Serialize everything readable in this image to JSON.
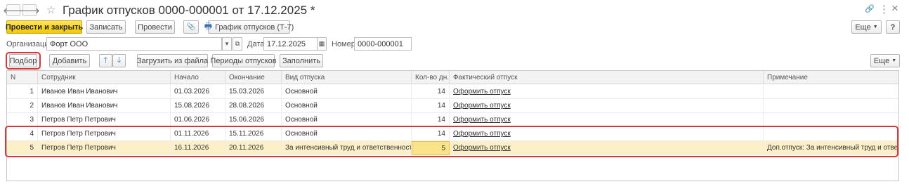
{
  "window": {
    "title": "График отпусков 0000-000001 от 17.12.2025 *",
    "back_icon": "arrow-left-icon",
    "forward_icon": "arrow-right-icon",
    "star_icon": "star-icon",
    "link_icon": "link-icon",
    "menu_icon": "more-vertical-icon",
    "close_icon": "close-icon",
    "back_glyph": "🡐",
    "forward_glyph": "🡒",
    "star_glyph": "☆",
    "link_glyph": "🔗",
    "menu_glyph": "⋮",
    "close_glyph": "×"
  },
  "toolbar": {
    "post_close": "Провести и закрыть",
    "save": "Записать",
    "post": "Провести",
    "attach_icon": "paperclip-icon",
    "attach_glyph": "📎",
    "print_icon": "printer-icon",
    "print_glyph": "🖶",
    "print_label": "График отпусков (Т-7)",
    "more": "Еще",
    "help": "?"
  },
  "header": {
    "org_label": "Организация:",
    "org_value": "Форт ООО",
    "date_label": "Дата:",
    "date_value": "17.12.2025",
    "number_label": "Номер:",
    "number_value": "0000-000001"
  },
  "table_toolbar": {
    "pick": "Подбор",
    "add": "Добавить",
    "up_icon": "arrow-up-icon",
    "down_icon": "arrow-down-icon",
    "up_glyph": "🡑",
    "down_glyph": "🡓",
    "load": "Загрузить из файла",
    "periods": "Периоды отпусков",
    "fill": "Заполнить",
    "more": "Еще"
  },
  "table": {
    "columns": [
      "N",
      "Сотрудник",
      "Начало",
      "Окончание",
      "Вид отпуска",
      "Кол-во дн.",
      "Фактический отпуск",
      "Примечание"
    ],
    "rows": [
      {
        "n": "1",
        "employee": "Иванов Иван Иванович",
        "start": "01.03.2026",
        "end": "15.03.2026",
        "type": "Основной",
        "days": "14",
        "actual": "Оформить отпуск",
        "note": ""
      },
      {
        "n": "2",
        "employee": "Иванов Иван Иванович",
        "start": "15.08.2026",
        "end": "28.08.2026",
        "type": "Основной",
        "days": "14",
        "actual": "Оформить отпуск",
        "note": ""
      },
      {
        "n": "3",
        "employee": "Петров Петр Петрович",
        "start": "01.06.2026",
        "end": "15.06.2026",
        "type": "Основной",
        "days": "14",
        "actual": "Оформить отпуск",
        "note": ""
      },
      {
        "n": "4",
        "employee": "Петров Петр Петрович",
        "start": "01.11.2026",
        "end": "15.11.2026",
        "type": "Основной",
        "days": "14",
        "actual": "Оформить отпуск",
        "note": ""
      },
      {
        "n": "5",
        "employee": "Петров Петр Петрович",
        "start": "16.11.2026",
        "end": "20.11.2026",
        "type": "За интенсивный труд и ответственность",
        "days": "5",
        "actual": "Оформить отпуск",
        "note": "Доп.отпуск: За интенсивный труд и ответс..."
      }
    ]
  },
  "colors": {
    "primary_button": "#f5c800",
    "highlight": "#d9363a",
    "selected_row": "#fbf0c8"
  }
}
